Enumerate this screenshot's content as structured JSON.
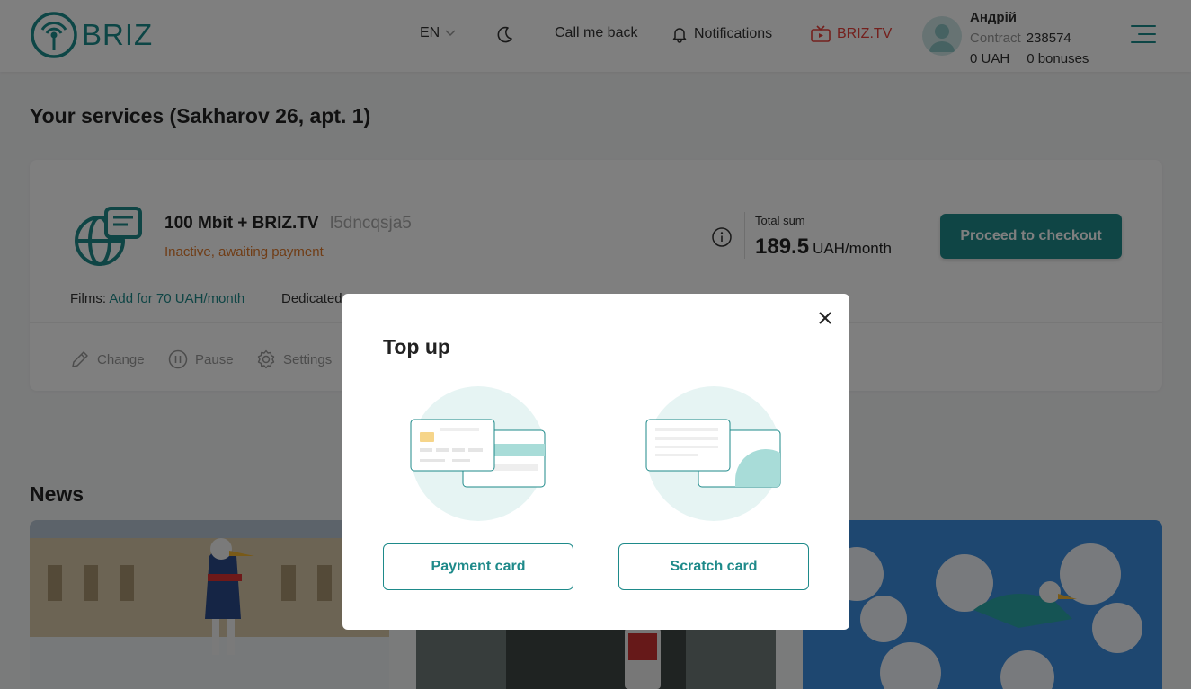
{
  "header": {
    "logo_text": "BRIZ",
    "lang": "EN",
    "call_back": "Call me back",
    "notifications": "Notifications",
    "briztv": "BRIZ.TV",
    "user": {
      "name": "Андрій",
      "contract_label": "Contract",
      "contract_number": "238574",
      "balance": "0 UAH",
      "bonuses": "0 bonuses"
    }
  },
  "page": {
    "title": "Your services (Sakharov 26, apt. 1)"
  },
  "service": {
    "name": "100 Mbit + BRIZ.TV",
    "code": "l5dncqsja5",
    "status": "Inactive, awaiting payment",
    "total_label": "Total sum",
    "total_value": "189.5",
    "total_unit": "UAH/month",
    "checkout_label": "Proceed to checkout",
    "addons": {
      "films_label": "Films:",
      "films_link": "Add for 70 UAH/month",
      "dedicated_label": "Dedicated"
    },
    "actions": {
      "change": "Change",
      "pause": "Pause",
      "settings": "Settings"
    }
  },
  "news": {
    "title": "News"
  },
  "modal": {
    "title": "Top up",
    "payment_card": "Payment card",
    "scratch_card": "Scratch card"
  },
  "colors": {
    "brand": "#1e8a8a",
    "status_warning": "#e07a2c",
    "briztv_red": "#e8403a"
  }
}
